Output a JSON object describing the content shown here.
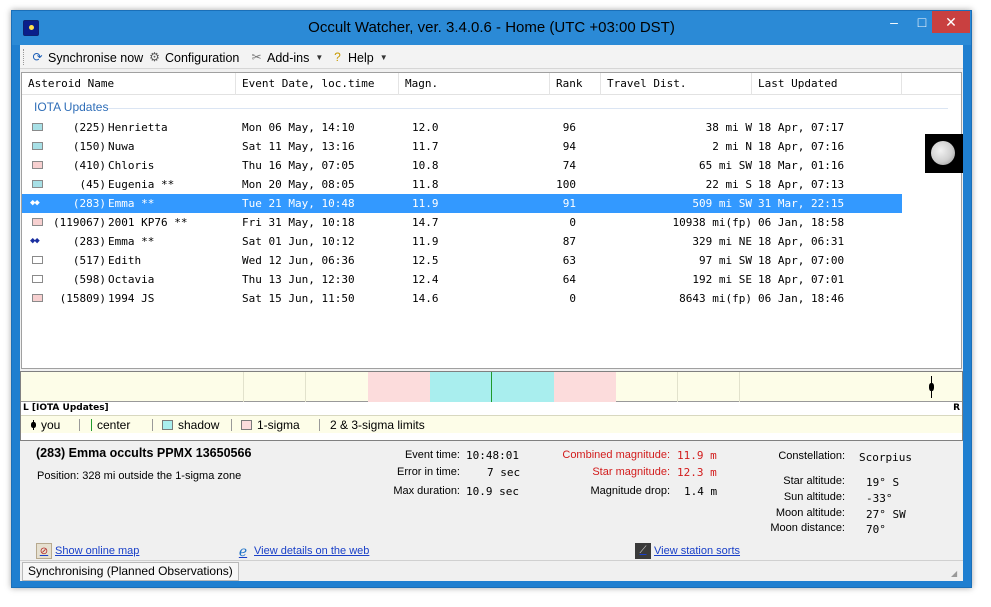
{
  "window": {
    "title": "Occult Watcher, ver. 3.4.0.6 - Home (UTC +03:00 DST)",
    "controls": {
      "minimize": "‒",
      "maximize": "□",
      "close": "✕"
    }
  },
  "toolbar": {
    "synchronise": "Synchronise now",
    "configuration": "Configuration",
    "addins": "Add-ins",
    "help": "Help"
  },
  "table": {
    "columns": [
      "Asteroid Name",
      "Event Date, loc.time",
      "Magn.",
      "Rank",
      "Travel Dist.",
      "Last Updated"
    ],
    "group": "IOTA Updates",
    "rows": [
      {
        "marker": "swatch",
        "color": "#a8e0e6",
        "num": "(225)",
        "name": "Henrietta",
        "date": "Mon 06 May, 14:10",
        "mag": "12.0",
        "rank": "96",
        "dist": "38 mi W",
        "updated": "18 Apr, 07:17"
      },
      {
        "marker": "swatch",
        "color": "#a8e0e6",
        "num": "(150)",
        "name": "Nuwa",
        "date": "Sat 11 May, 13:16",
        "mag": "11.7",
        "rank": "94",
        "dist": "2 mi N",
        "updated": "18 Apr, 07:16"
      },
      {
        "marker": "swatch",
        "color": "#f7d0d0",
        "num": "(410)",
        "name": "Chloris",
        "date": "Thu 16 May, 07:05",
        "mag": "10.8",
        "rank": "74",
        "dist": "65 mi SW",
        "updated": "18 Mar, 01:16"
      },
      {
        "marker": "swatch",
        "color": "#a8e0e6",
        "num": "(45)",
        "name": "Eugenia **",
        "date": "Mon 20 May, 08:05",
        "mag": "11.8",
        "rank": "100",
        "dist": "22 mi S",
        "updated": "18 Apr, 07:13"
      },
      {
        "marker": "dots",
        "color": "#3399ff",
        "num": "(283)",
        "name": "Emma **",
        "date": "Tue 21 May, 10:48",
        "mag": "11.9",
        "rank": "91",
        "dist": "509 mi SW",
        "updated": "31 Mar, 22:15",
        "selected": true
      },
      {
        "marker": "swatch",
        "color": "#f7d0d0",
        "num": "(119067)",
        "name": "2001 KP76 **",
        "date": "Fri 31 May, 10:18",
        "mag": "14.7",
        "rank": "0",
        "dist": "10938 mi(fp)",
        "updated": "06 Jan, 18:58"
      },
      {
        "marker": "dots",
        "color": "#1b2fa0",
        "num": "(283)",
        "name": "Emma **",
        "date": "Sat 01 Jun, 10:12",
        "mag": "11.9",
        "rank": "87",
        "dist": "329 mi NE",
        "updated": "18 Apr, 06:31"
      },
      {
        "marker": "swatch",
        "color": "#ffffff",
        "num": "(517)",
        "name": "Edith",
        "date": "Wed 12 Jun, 06:36",
        "mag": "12.5",
        "rank": "63",
        "dist": "97 mi SW",
        "updated": "18 Apr, 07:00"
      },
      {
        "marker": "swatch",
        "color": "#ffffff",
        "num": "(598)",
        "name": "Octavia",
        "date": "Thu 13 Jun, 12:30",
        "mag": "12.4",
        "rank": "64",
        "dist": "192 mi SE",
        "updated": "18 Apr, 07:01"
      },
      {
        "marker": "swatch",
        "color": "#f7d0d0",
        "num": "(15809)",
        "name": "1994 JS",
        "date": "Sat 15 Jun, 11:50",
        "mag": "14.6",
        "rank": "0",
        "dist": "8643 mi(fp)",
        "updated": "06 Jan, 18:46"
      }
    ]
  },
  "track": {
    "left_label": "L [IOTA Updates]",
    "right_label": "R",
    "colors": {
      "band": "#fdfde8",
      "sigma": "#fcdcdc",
      "shadow": "#a9eeee",
      "center": "#1f9a2c"
    },
    "legend": {
      "you": "you",
      "center": "center",
      "shadow": "shadow",
      "sigma1": "1-sigma",
      "sigma23": "2 & 3-sigma limits"
    }
  },
  "details": {
    "title": "(283) Emma occults PPMX 13650566",
    "position": "Position:  328 mi outside the 1-sigma zone",
    "event_time_label": "Event time:",
    "event_time": "10:48:01",
    "error_label": "Error in time:",
    "error": "7 sec",
    "maxdur_label": "Max duration:",
    "maxdur": "10.9 sec",
    "combmag_label": "Combined magnitude:",
    "combmag": "11.9 m",
    "starmag_label": "Star magnitude:",
    "starmag": "12.3 m",
    "magdrop_label": "Magnitude drop:",
    "magdrop": "1.4 m",
    "constellation_label": "Constellation:",
    "constellation": "Scorpius",
    "star_alt_label": "Star altitude:",
    "star_alt": "19° S",
    "sun_alt_label": "Sun altitude:",
    "sun_alt": "-33°",
    "moon_alt_label": "Moon altitude:",
    "moon_alt": "27° SW",
    "moon_dist_label": "Moon distance:",
    "moon_dist": "70°",
    "link_map": "Show online map",
    "link_web": "View details on the web",
    "link_station": "View station sorts"
  },
  "status": {
    "text": "Synchronising (Planned Observations)"
  }
}
